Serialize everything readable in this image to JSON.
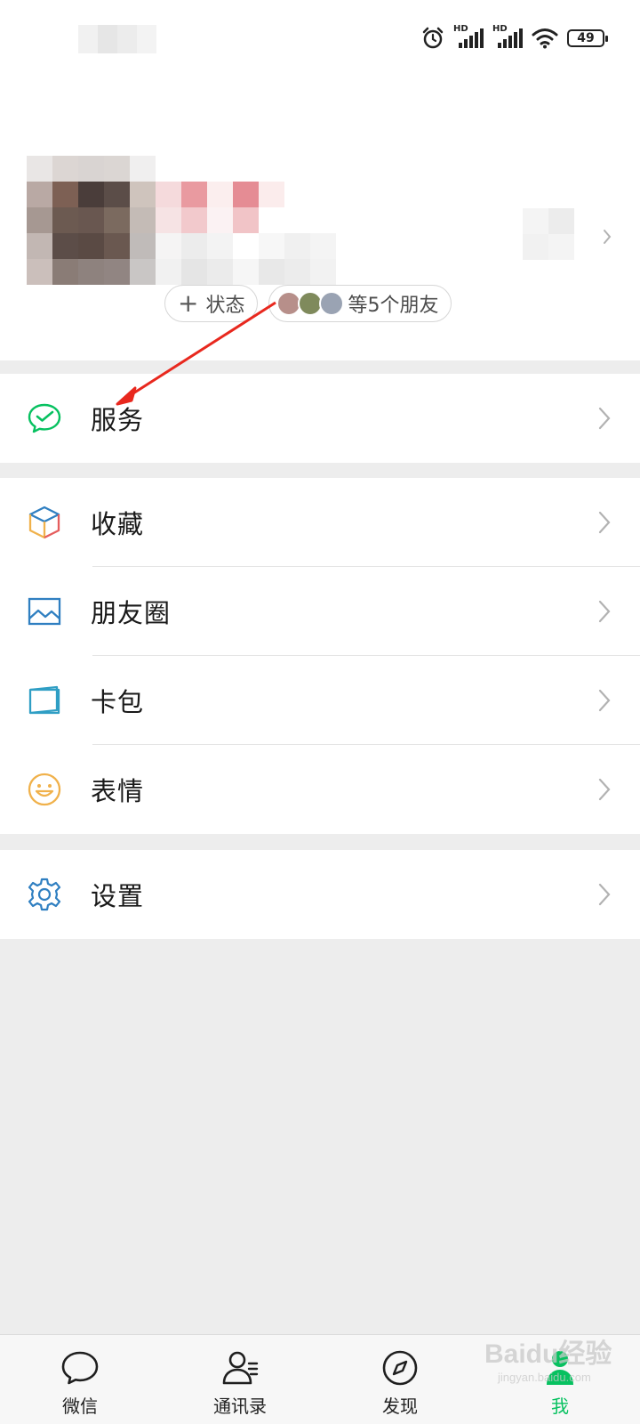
{
  "status_bar": {
    "battery_level": "49",
    "network_1": "HD",
    "network_2": "HD",
    "icons": [
      "alarm-icon",
      "signal-icon",
      "signal-icon",
      "wifi-icon",
      "battery-icon"
    ]
  },
  "profile": {
    "chips": {
      "status_label": "状态",
      "friends_label": "等5个朋友"
    }
  },
  "menu": {
    "service": {
      "label": "服务",
      "icon": "wechat-pay-icon",
      "color": "#07c160"
    },
    "favorites": {
      "label": "收藏",
      "icon": "cube-icon"
    },
    "moments": {
      "label": "朋友圈",
      "icon": "picture-icon",
      "color": "#2f7fc1"
    },
    "cards": {
      "label": "卡包",
      "icon": "wallet-card-icon",
      "color": "#2f9ec4"
    },
    "stickers": {
      "label": "表情",
      "icon": "smiley-icon",
      "color": "#f0b14b"
    },
    "settings": {
      "label": "设置",
      "icon": "gear-icon",
      "color": "#2f7fc1"
    }
  },
  "tabbar": {
    "tabs": [
      {
        "label": "微信",
        "icon": "chat-bubble-icon",
        "active": false
      },
      {
        "label": "通讯录",
        "icon": "contacts-icon",
        "active": false
      },
      {
        "label": "发现",
        "icon": "compass-icon",
        "active": false
      },
      {
        "label": "我",
        "icon": "person-icon",
        "active": true
      }
    ],
    "active_color": "#07c160"
  },
  "watermark": {
    "text": "Baidu经验",
    "sub": "jingyan.baidu.com"
  },
  "colors": {
    "background": "#ededed",
    "card": "#ffffff",
    "accent": "#07c160",
    "annotation": "#e8281e"
  }
}
